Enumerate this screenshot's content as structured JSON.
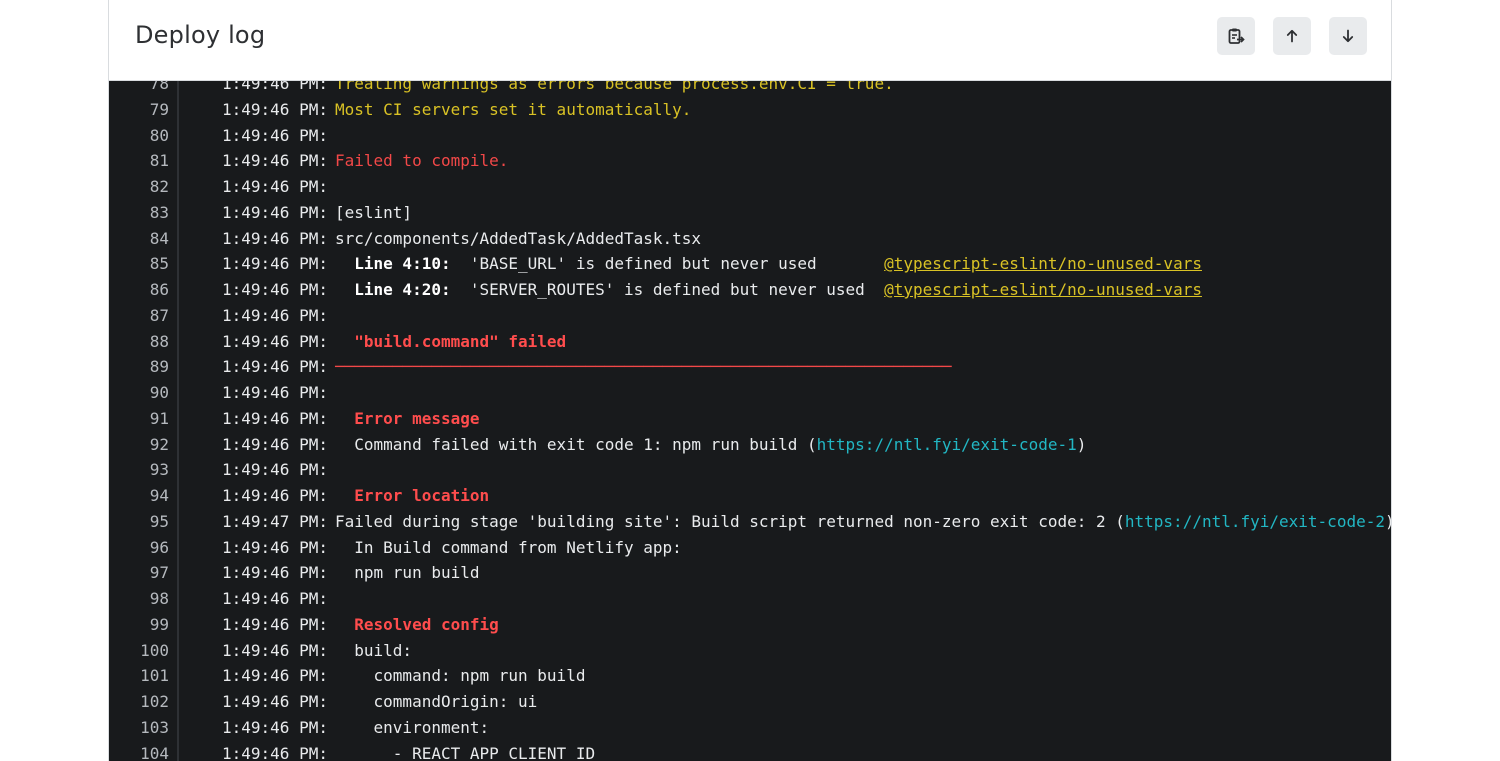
{
  "header": {
    "title": "Deploy log",
    "buttons": [
      {
        "name": "copy-log-button",
        "icon": "clipboard-copy-icon"
      },
      {
        "name": "scroll-top-button",
        "icon": "arrow-up-icon"
      },
      {
        "name": "scroll-bottom-button",
        "icon": "arrow-down-icon"
      }
    ]
  },
  "colors": {
    "log_background": "#181a1c",
    "warning": "#d9c225",
    "error": "#f24848",
    "link": "#22b7c4"
  },
  "log": {
    "lines": [
      {
        "n": "78",
        "t": "1:49:46 PM:",
        "segs": [
          {
            "x": "Treating warnings as errors because process.env.CI = true.",
            "c": "yellow"
          }
        ]
      },
      {
        "n": "79",
        "t": "1:49:46 PM:",
        "segs": [
          {
            "x": "Most CI servers set it automatically.",
            "c": "yellow"
          }
        ]
      },
      {
        "n": "80",
        "t": "1:49:46 PM:",
        "segs": []
      },
      {
        "n": "81",
        "t": "1:49:46 PM:",
        "segs": [
          {
            "x": "Failed to compile.",
            "c": "red"
          }
        ]
      },
      {
        "n": "82",
        "t": "1:49:46 PM:",
        "segs": []
      },
      {
        "n": "83",
        "t": "1:49:46 PM:",
        "segs": [
          {
            "x": "[eslint]",
            "c": "default"
          }
        ]
      },
      {
        "n": "84",
        "t": "1:49:46 PM:",
        "segs": [
          {
            "x": "src/components/AddedTask/AddedTask.tsx",
            "c": "default"
          }
        ]
      },
      {
        "n": "85",
        "t": "1:49:46 PM:",
        "segs": [
          {
            "x": "  ",
            "c": "default"
          },
          {
            "x": "Line 4:10:",
            "c": "bold"
          },
          {
            "x": "  'BASE_URL' is defined but never used       ",
            "c": "default"
          },
          {
            "x": "@typescript-eslint/no-unused-vars",
            "c": "ulyellow"
          }
        ]
      },
      {
        "n": "86",
        "t": "1:49:46 PM:",
        "segs": [
          {
            "x": "  ",
            "c": "default"
          },
          {
            "x": "Line 4:20:",
            "c": "bold"
          },
          {
            "x": "  'SERVER_ROUTES' is defined but never used  ",
            "c": "default"
          },
          {
            "x": "@typescript-eslint/no-unused-vars",
            "c": "ulyellow"
          }
        ]
      },
      {
        "n": "87",
        "t": "1:49:46 PM:",
        "segs": []
      },
      {
        "n": "88",
        "t": "1:49:46 PM:",
        "segs": [
          {
            "x": "  ",
            "c": "default"
          },
          {
            "x": "\"build.command\" failed",
            "c": "redb"
          }
        ]
      },
      {
        "n": "89",
        "t": "1:49:46 PM:",
        "segs": [
          {
            "x": "────────────────────────────────────────────────────────────────",
            "c": "rule"
          }
        ]
      },
      {
        "n": "90",
        "t": "1:49:46 PM:",
        "segs": []
      },
      {
        "n": "91",
        "t": "1:49:46 PM:",
        "segs": [
          {
            "x": "  ",
            "c": "default"
          },
          {
            "x": "Error message",
            "c": "redb"
          }
        ]
      },
      {
        "n": "92",
        "t": "1:49:46 PM:",
        "segs": [
          {
            "x": "  Command failed with exit code 1: npm run build (",
            "c": "default"
          },
          {
            "x": "https://ntl.fyi/exit-code-1",
            "c": "link"
          },
          {
            "x": ")",
            "c": "default"
          }
        ]
      },
      {
        "n": "93",
        "t": "1:49:46 PM:",
        "segs": []
      },
      {
        "n": "94",
        "t": "1:49:46 PM:",
        "segs": [
          {
            "x": "  ",
            "c": "default"
          },
          {
            "x": "Error location",
            "c": "redb"
          }
        ]
      },
      {
        "n": "95",
        "t": "1:49:47 PM:",
        "segs": [
          {
            "x": "Failed during stage 'building site': Build script returned non-zero exit code: 2 (",
            "c": "default"
          },
          {
            "x": "https://ntl.fyi/exit-code-2",
            "c": "link"
          },
          {
            "x": ")",
            "c": "default"
          }
        ]
      },
      {
        "n": "96",
        "t": "1:49:46 PM:",
        "segs": [
          {
            "x": "  In Build command from Netlify app:",
            "c": "default"
          }
        ]
      },
      {
        "n": "97",
        "t": "1:49:46 PM:",
        "segs": [
          {
            "x": "  npm run build",
            "c": "default"
          }
        ]
      },
      {
        "n": "98",
        "t": "1:49:46 PM:",
        "segs": []
      },
      {
        "n": "99",
        "t": "1:49:46 PM:",
        "segs": [
          {
            "x": "  ",
            "c": "default"
          },
          {
            "x": "Resolved config",
            "c": "redb"
          }
        ]
      },
      {
        "n": "100",
        "t": "1:49:46 PM:",
        "segs": [
          {
            "x": "  build:",
            "c": "default"
          }
        ]
      },
      {
        "n": "101",
        "t": "1:49:46 PM:",
        "segs": [
          {
            "x": "    command: npm run build",
            "c": "default"
          }
        ]
      },
      {
        "n": "102",
        "t": "1:49:46 PM:",
        "segs": [
          {
            "x": "    commandOrigin: ui",
            "c": "default"
          }
        ]
      },
      {
        "n": "103",
        "t": "1:49:46 PM:",
        "segs": [
          {
            "x": "    environment:",
            "c": "default"
          }
        ]
      },
      {
        "n": "104",
        "t": "1:49:46 PM:",
        "segs": [
          {
            "x": "      - REACT_APP_CLIENT_ID",
            "c": "default"
          }
        ]
      }
    ]
  }
}
